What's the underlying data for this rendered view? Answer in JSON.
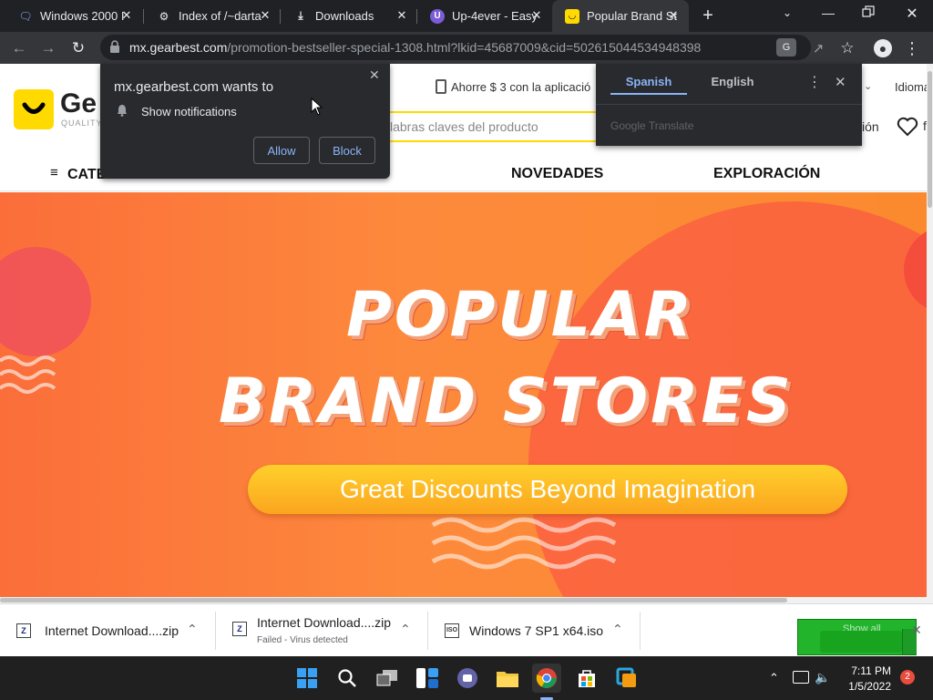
{
  "tabs": [
    {
      "title": "Windows 2000 I",
      "icon": "chat-bubble-icon"
    },
    {
      "title": "Index of /~darta",
      "icon": "archive-icon"
    },
    {
      "title": "Downloads",
      "icon": "download-icon"
    },
    {
      "title": "Up-4ever - Easy",
      "icon": "up4ever-logo-icon"
    },
    {
      "title": "Popular Brand St",
      "icon": "gearbest-logo-icon",
      "active": true
    }
  ],
  "toolbar": {
    "url_domain": "mx.gearbest.com",
    "url_path": "/promotion-bestseller-special-1308.html?lkid=45687009&cid=502615044534948398"
  },
  "site": {
    "logo_text": "Ge",
    "logo_sub": "QUALITY",
    "promo_text": "Ahorre $ 3 con la aplicació",
    "lang_text": "Idioma",
    "search_placeholder": "labras claves del producto",
    "signin_partial": "ión",
    "wishlist_partial": "f",
    "categories_label": "CATEGORÍAS",
    "nav_items": [
      "NOVEDADES",
      "EXPLORACIÓN"
    ]
  },
  "banner": {
    "line1": "POPULAR",
    "line2": "BRAND STORES",
    "cta": "Great Discounts Beyond Imagination"
  },
  "notification_popup": {
    "title": "mx.gearbest.com wants to",
    "item": "Show notifications",
    "allow": "Allow",
    "block": "Block"
  },
  "translate_popup": {
    "tab_source": "Spanish",
    "tab_target": "English",
    "brand": "Google Translate"
  },
  "downloads": [
    {
      "name": "Internet Download....zip",
      "status": ""
    },
    {
      "name": "Internet Download....zip",
      "status": "Failed - Virus detected"
    },
    {
      "name": "Windows 7 SP1 x64.iso",
      "status": ""
    }
  ],
  "downloads_show_all": "Show all",
  "taskbar": {
    "time": "7:11 PM",
    "date": "1/5/2022",
    "notifications": "2"
  },
  "colors": {
    "accent_blue": "#8ab4f8",
    "gearbest_yellow": "#ffda00",
    "banner_orange": "#fb7a36"
  }
}
